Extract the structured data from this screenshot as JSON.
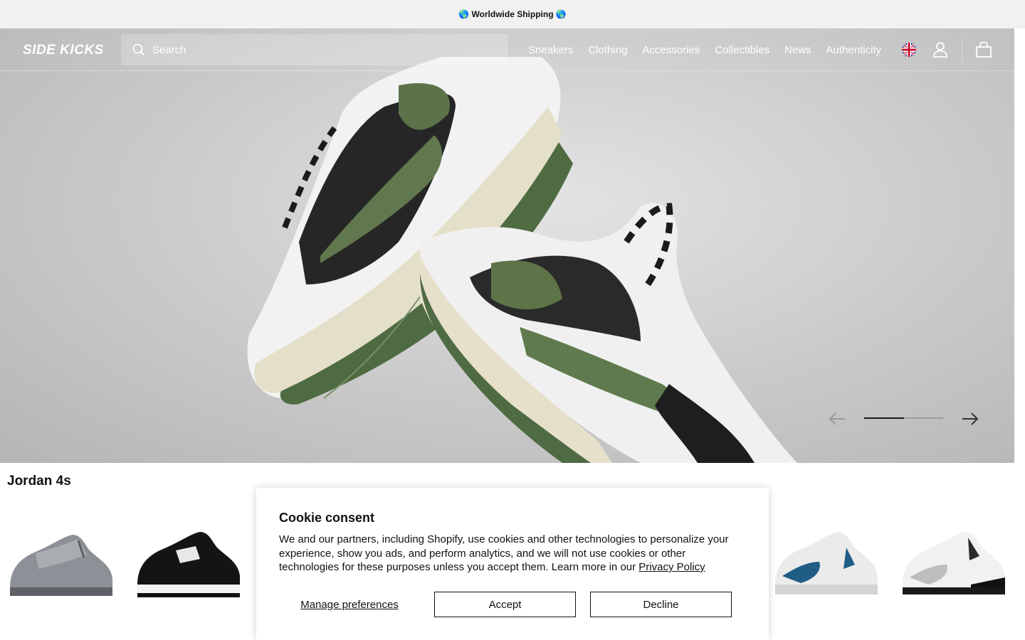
{
  "announcement": {
    "text": "🌎 Worldwide Shipping 🌎"
  },
  "header": {
    "logo": "SIDE KICKS",
    "search": {
      "placeholder": "Search",
      "value": ""
    },
    "nav": [
      "Sneakers",
      "Clothing",
      "Accessories",
      "Collectibles",
      "News",
      "Authenticity"
    ],
    "icons": [
      "uk-flag-icon",
      "account-icon",
      "cart-icon"
    ]
  },
  "hero": {
    "slider": {
      "current_slide": 1,
      "total_slides": 2,
      "progress": 0.5
    },
    "icons": [
      "arrow-left-icon",
      "arrow-right-icon"
    ]
  },
  "section": {
    "title": "Jordan 4s",
    "products": [
      {
        "colorway": "grey"
      },
      {
        "colorway": "black-white"
      },
      {
        "colorway": "white-blue"
      },
      {
        "colorway": "white-black-cement"
      }
    ]
  },
  "cookie": {
    "title": "Cookie consent",
    "body": "We and our partners, including Shopify, use cookies and other technologies to personalize your experience, show you ads, and perform analytics, and we will not use cookies or other technologies for these purposes unless you accept them. Learn more in our ",
    "privacy_link": "Privacy Policy",
    "manage_label": "Manage preferences",
    "accept_label": "Accept",
    "decline_label": "Decline"
  },
  "colors": {
    "announcement_bg": "#f1f1f1",
    "header_text": "#ffffff",
    "text": "#111111"
  }
}
